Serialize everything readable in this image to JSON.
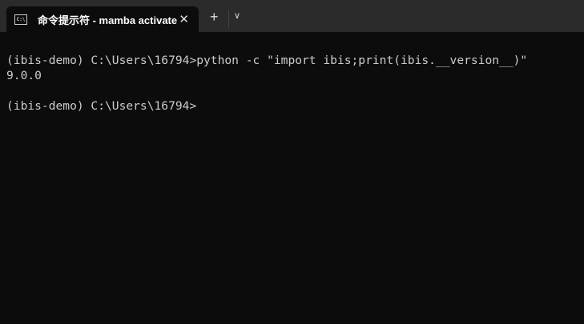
{
  "tab": {
    "title": "命令提示符 - mamba  activate",
    "icon": "cmd-icon"
  },
  "lines": [
    "(ibis-demo) C:\\Users\\16794>python -c \"import ibis;print(ibis.__version__)\"",
    "9.0.0",
    "",
    "(ibis-demo) C:\\Users\\16794>"
  ]
}
